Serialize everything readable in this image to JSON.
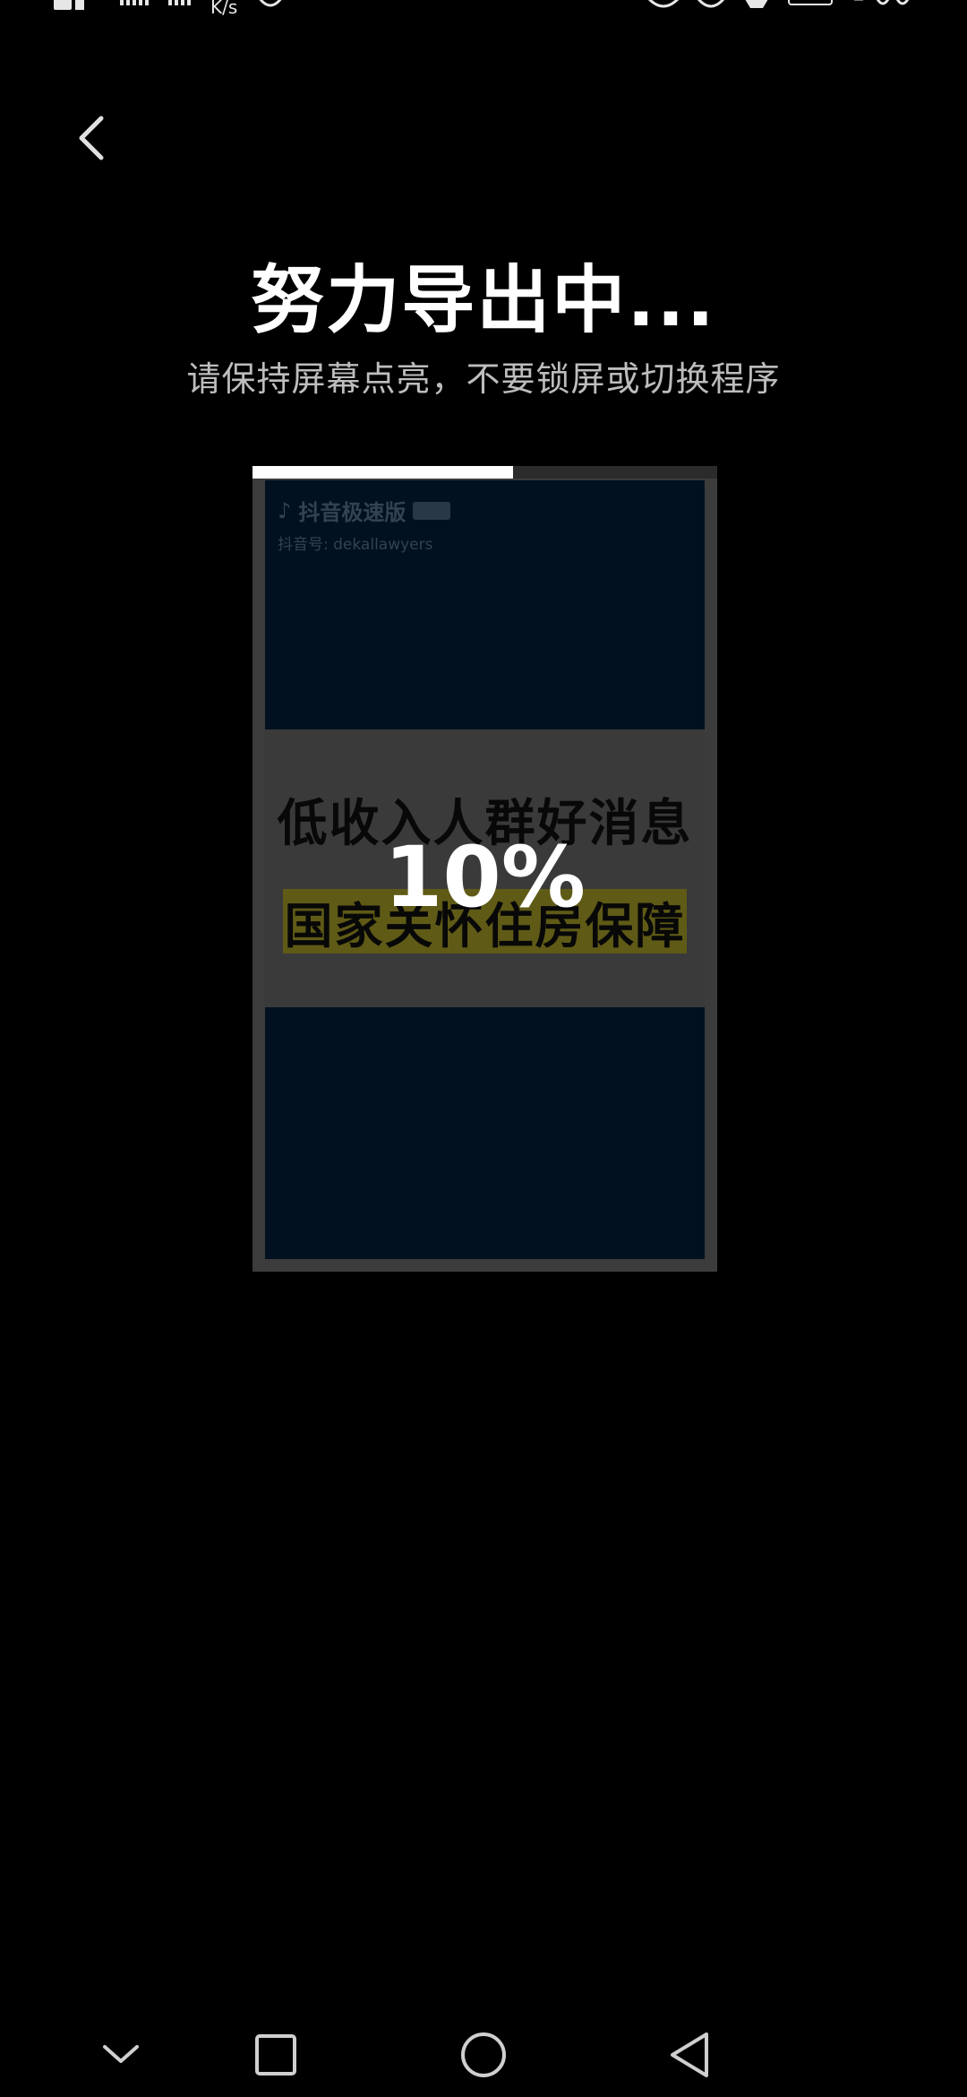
{
  "status_bar": {
    "speed_unit": "K/s",
    "icons": [
      "nfc-icon",
      "signal-4g-icon",
      "signal-icon",
      "netspeed-icon",
      "vpn-icon",
      "eye-icon",
      "silent-icon",
      "bell-off-icon",
      "battery-icon",
      "clock-icon"
    ]
  },
  "header": {
    "back_icon": "chevron-left-icon",
    "title": "努力导出中...",
    "subtitle": "请保持屏幕点亮，不要锁屏或切换程序"
  },
  "preview": {
    "progress": 0.56,
    "percent_text": "10%",
    "watermark": {
      "app_name": "抖音极速版",
      "id_line": "抖音号: dekallawyers"
    },
    "banner": {
      "line1": "低收入人群好消息",
      "line2": "国家关怀住房保障"
    }
  },
  "nav_bar": {
    "icons": [
      "chevron-down-icon",
      "square-icon",
      "circle-icon",
      "triangle-back-icon"
    ]
  },
  "colors": {
    "background": "#000000",
    "subtitle": "#bdbdbd",
    "frame": "#3c3c3c",
    "video_bg": "#02111f"
  }
}
